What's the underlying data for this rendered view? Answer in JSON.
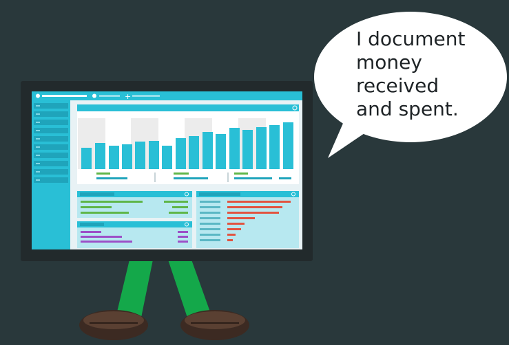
{
  "speech_bubble": {
    "text": "I document\nmoney\nreceived\nand spent."
  },
  "colors": {
    "background": "#29383b",
    "monitor_frame": "#222a2c",
    "screen_bg": "#e8f2f5",
    "accent_teal": "#29bfd6",
    "bar_fill": "#29bfd6",
    "panel_light": "#b7e8f0",
    "green": "#5fb648",
    "red": "#e2533f",
    "purple": "#9c4fc7",
    "legs": "#14a84a",
    "shoes": "#4a3428"
  },
  "icons": [
    "monitor-icon",
    "speech-bubble-icon"
  ]
}
